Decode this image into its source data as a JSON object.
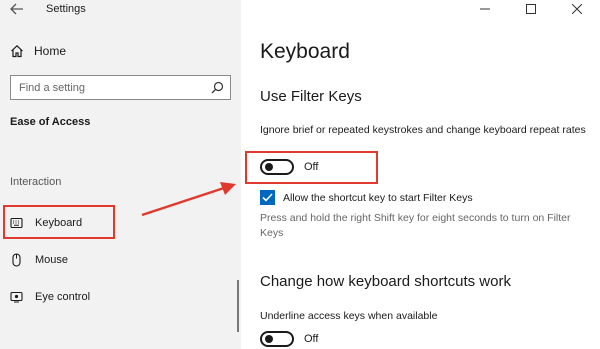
{
  "window": {
    "title": "Settings"
  },
  "sidebar": {
    "home_label": "Home",
    "search_placeholder": "Find a setting",
    "section_title": "Ease of Access",
    "group_label": "Interaction",
    "items": [
      {
        "label": "Keyboard",
        "icon": "keyboard-icon",
        "selected": true
      },
      {
        "label": "Mouse",
        "icon": "mouse-icon"
      },
      {
        "label": "Eye control",
        "icon": "eye-control-icon"
      }
    ]
  },
  "main": {
    "title": "Keyboard",
    "filter_keys": {
      "heading": "Use Filter Keys",
      "description": "Ignore brief or repeated keystrokes and change keyboard repeat rates",
      "toggle_state": "Off",
      "checkbox_label": "Allow the shortcut key to start Filter Keys",
      "checkbox_checked": true,
      "hint": "Press and hold the right Shift key for eight seconds to turn on Filter Keys"
    },
    "shortcuts": {
      "heading": "Change how keyboard shortcuts work",
      "underline_label": "Underline access keys when available",
      "toggle_state": "Off"
    }
  },
  "colors": {
    "accent": "#0067c0",
    "highlight": "#e03a2e"
  }
}
